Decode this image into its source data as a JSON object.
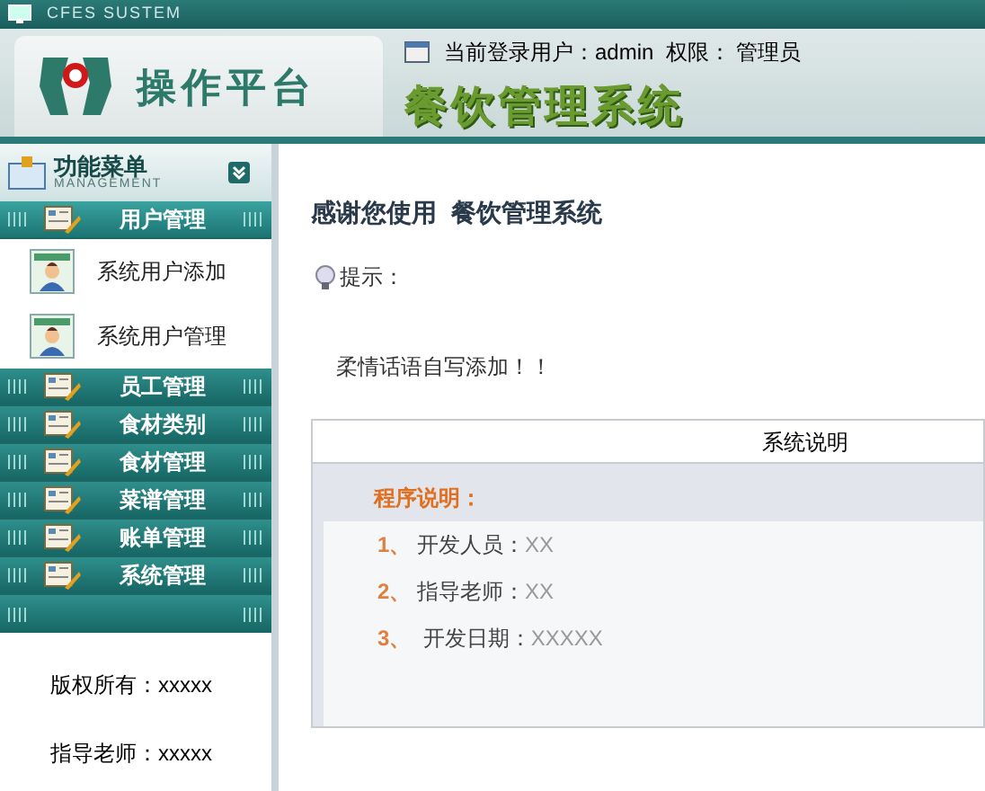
{
  "topbar": {
    "system_name": "CFES SUSTEM"
  },
  "header": {
    "platform_title": "操作平台",
    "app_title": "餐饮管理系统",
    "login_info": "当前登录用户：admin  权限： 管理员"
  },
  "sidebar": {
    "title": "功能菜单",
    "subtitle": "MANAGEMENT",
    "groups": [
      {
        "label": "用户管理",
        "expanded": true,
        "children": [
          {
            "label": "系统用户添加"
          },
          {
            "label": "系统用户管理"
          }
        ]
      },
      {
        "label": "员工管理",
        "expanded": false
      },
      {
        "label": "食材类别",
        "expanded": false
      },
      {
        "label": "食材管理",
        "expanded": false
      },
      {
        "label": "菜谱管理",
        "expanded": false
      },
      {
        "label": "账单管理",
        "expanded": false
      },
      {
        "label": "系统管理",
        "expanded": false
      }
    ],
    "footer": [
      "版权所有：xxxxx",
      "指导老师：xxxxx"
    ]
  },
  "main": {
    "heading": "感谢您使用  餐饮管理系统",
    "tip_label": "提示：",
    "tip_text": "柔情话语自写添加！！",
    "panel": {
      "title": "系统说明",
      "section_title": "程序说明：",
      "items": [
        {
          "number": "1、",
          "text": "开发人员：",
          "value": "XX"
        },
        {
          "number": "2、",
          "text": "指导老师：",
          "value": "XX"
        },
        {
          "number": "3、",
          "text": " 开发日期：",
          "value": "XXXXX"
        }
      ]
    }
  }
}
